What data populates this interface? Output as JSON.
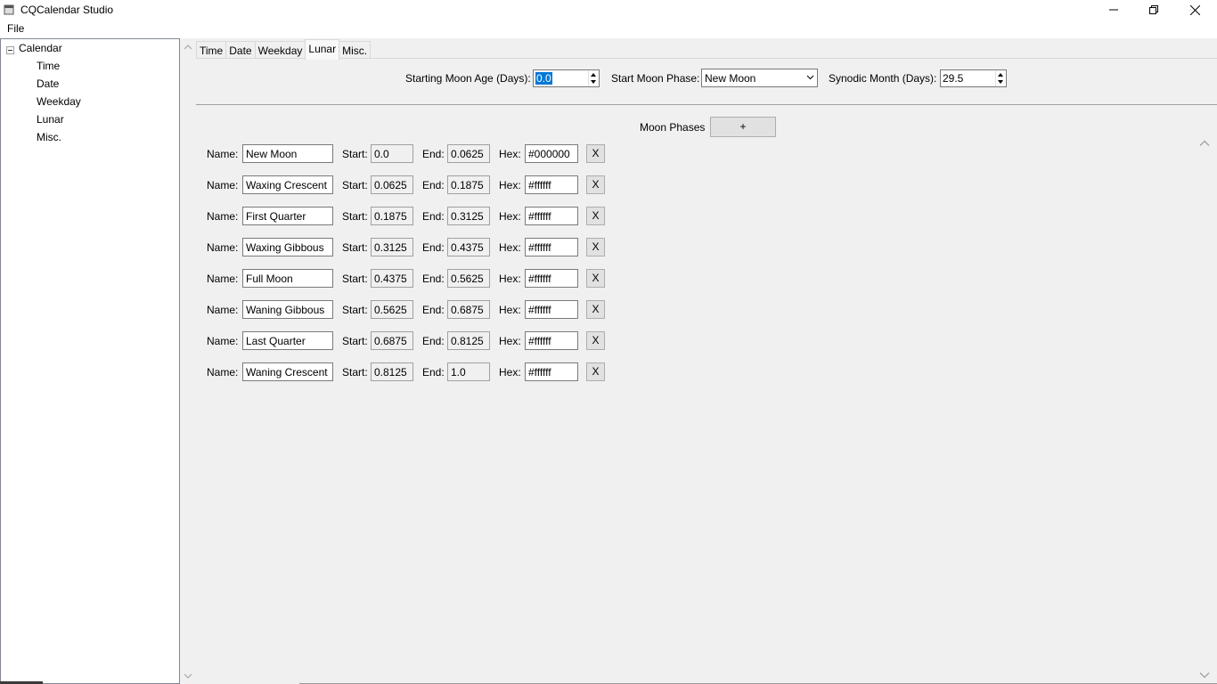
{
  "window": {
    "title": "CQCalendar Studio"
  },
  "menu": {
    "file": "File"
  },
  "tree": {
    "root": "Calendar",
    "children": [
      "Time",
      "Date",
      "Weekday",
      "Lunar",
      "Misc."
    ]
  },
  "tabs": [
    "Time",
    "Date",
    "Weekday",
    "Lunar",
    "Misc."
  ],
  "active_tab": "Lunar",
  "lunar": {
    "starting_moon_age_label": "Starting Moon Age (Days):",
    "starting_moon_age_value": "0.0",
    "start_moon_phase_label": "Start Moon Phase:",
    "start_moon_phase_value": "New Moon",
    "synodic_month_label": "Synodic Month (Days):",
    "synodic_month_value": "29.5",
    "moon_phases_label": "Moon Phases",
    "add_button": "+",
    "field_labels": {
      "name": "Name:",
      "start": "Start:",
      "end": "End:",
      "hex": "Hex:",
      "delete": "X"
    },
    "phases": [
      {
        "name": "New Moon",
        "start": "0.0",
        "end": "0.0625",
        "hex": "#000000"
      },
      {
        "name": "Waxing Crescent",
        "start": "0.0625",
        "end": "0.1875",
        "hex": "#ffffff"
      },
      {
        "name": "First Quarter",
        "start": "0.1875",
        "end": "0.3125",
        "hex": "#ffffff"
      },
      {
        "name": "Waxing Gibbous",
        "start": "0.3125",
        "end": "0.4375",
        "hex": "#ffffff"
      },
      {
        "name": "Full Moon",
        "start": "0.4375",
        "end": "0.5625",
        "hex": "#ffffff"
      },
      {
        "name": "Waning Gibbous",
        "start": "0.5625",
        "end": "0.6875",
        "hex": "#ffffff"
      },
      {
        "name": "Last Quarter",
        "start": "0.6875",
        "end": "0.8125",
        "hex": "#ffffff"
      },
      {
        "name": "Waning Crescent",
        "start": "0.8125",
        "end": "1.0",
        "hex": "#ffffff"
      }
    ]
  },
  "colors": {
    "selection": "#0078d7",
    "panel": "#f0f0f0",
    "field": "#ffffff"
  }
}
